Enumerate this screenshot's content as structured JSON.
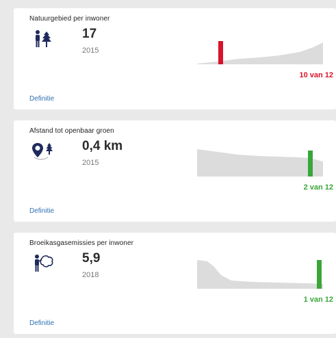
{
  "cards": [
    {
      "title": "Natuurgebied per inwoner",
      "icon": "people-tree-icon",
      "value": "17",
      "year": "2015",
      "rank": "10 van 12",
      "rank_color": "#d7142b",
      "link": "Definitie"
    },
    {
      "title": "Afstand tot openbaar groen",
      "icon": "location-tree-icon",
      "value": "0,4 km",
      "year": "2015",
      "rank": "2 van 12",
      "rank_color": "#3aa63a",
      "link": "Definitie"
    },
    {
      "title": "Broeikasgasemissies per inwoner",
      "icon": "person-emission-icon",
      "value": "5,9",
      "year": "2018",
      "rank": "1 van 12",
      "rank_color": "#3aa63a",
      "link": "Definitie"
    }
  ],
  "colors": {
    "icon": "#1f2a5c",
    "area": "#dcdcdc",
    "red": "#d7142b",
    "green": "#3aa63a",
    "link": "#2f6fb3"
  }
}
